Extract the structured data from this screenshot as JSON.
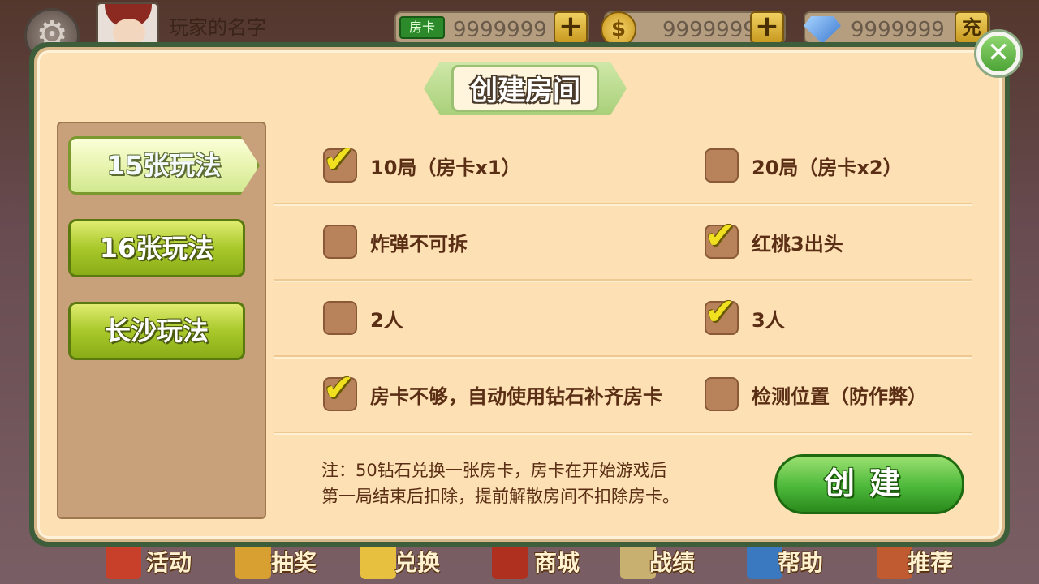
{
  "top": {
    "player_name": "玩家的名字",
    "room_card_label": "房卡",
    "room_cards": "9999999",
    "coins": "9999999",
    "diamonds": "9999999",
    "recharge_label": "充"
  },
  "dialog": {
    "title": "创建房间",
    "close_symbol": "✕",
    "modes": [
      "15张玩法",
      "16张玩法",
      "长沙玩法"
    ],
    "active_mode": 0,
    "options": [
      {
        "label": "10局（房卡x1）",
        "checked": true
      },
      {
        "label": "20局（房卡x2）",
        "checked": false
      },
      {
        "label": "炸弹不可拆",
        "checked": false
      },
      {
        "label": "红桃3出头",
        "checked": true
      },
      {
        "label": "2人",
        "checked": false
      },
      {
        "label": "3人",
        "checked": true
      },
      {
        "label": "房卡不够，自动使用钻石补齐房卡",
        "checked": true
      },
      {
        "label": "检测位置（防作弊）",
        "checked": false
      }
    ],
    "note_line1": "注：50钻石兑换一张房卡，房卡在开始游戏后",
    "note_line2": "第一局结束后扣除，提前解散房间不扣除房卡。",
    "create_label": "创建",
    "check_symbol": "✔"
  },
  "bottom_nav": [
    "活动",
    "抽奖",
    "兑换",
    "商城",
    "战绩",
    "帮助",
    "推荐"
  ],
  "icons": {
    "settings": "gear-icon",
    "coin": "coin-icon",
    "diamond": "diamond-icon"
  },
  "colors": {
    "dialog_bg": "#fde0b4",
    "frame": "#3e5d3a",
    "create_button": "#4cb83a",
    "mode_button": "#a8c82a"
  }
}
